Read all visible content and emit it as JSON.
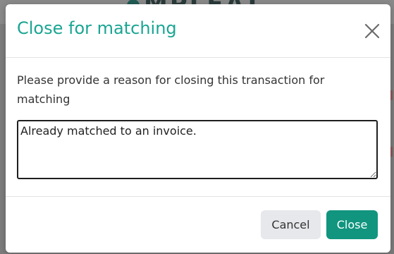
{
  "background": {
    "logo_text": "MPLEAT"
  },
  "dialog": {
    "title": "Close for matching",
    "close_icon": "close-x-icon",
    "prompt": "Please provide a reason for closing this transaction for matching",
    "reason_value": "Already matched to an invoice.",
    "buttons": {
      "cancel_label": "Cancel",
      "close_label": "Close"
    }
  },
  "colors": {
    "title_accent": "#1aa593",
    "primary_button": "#11957f",
    "secondary_button": "#e6e8eb",
    "overlay": "#7d7d7d"
  }
}
